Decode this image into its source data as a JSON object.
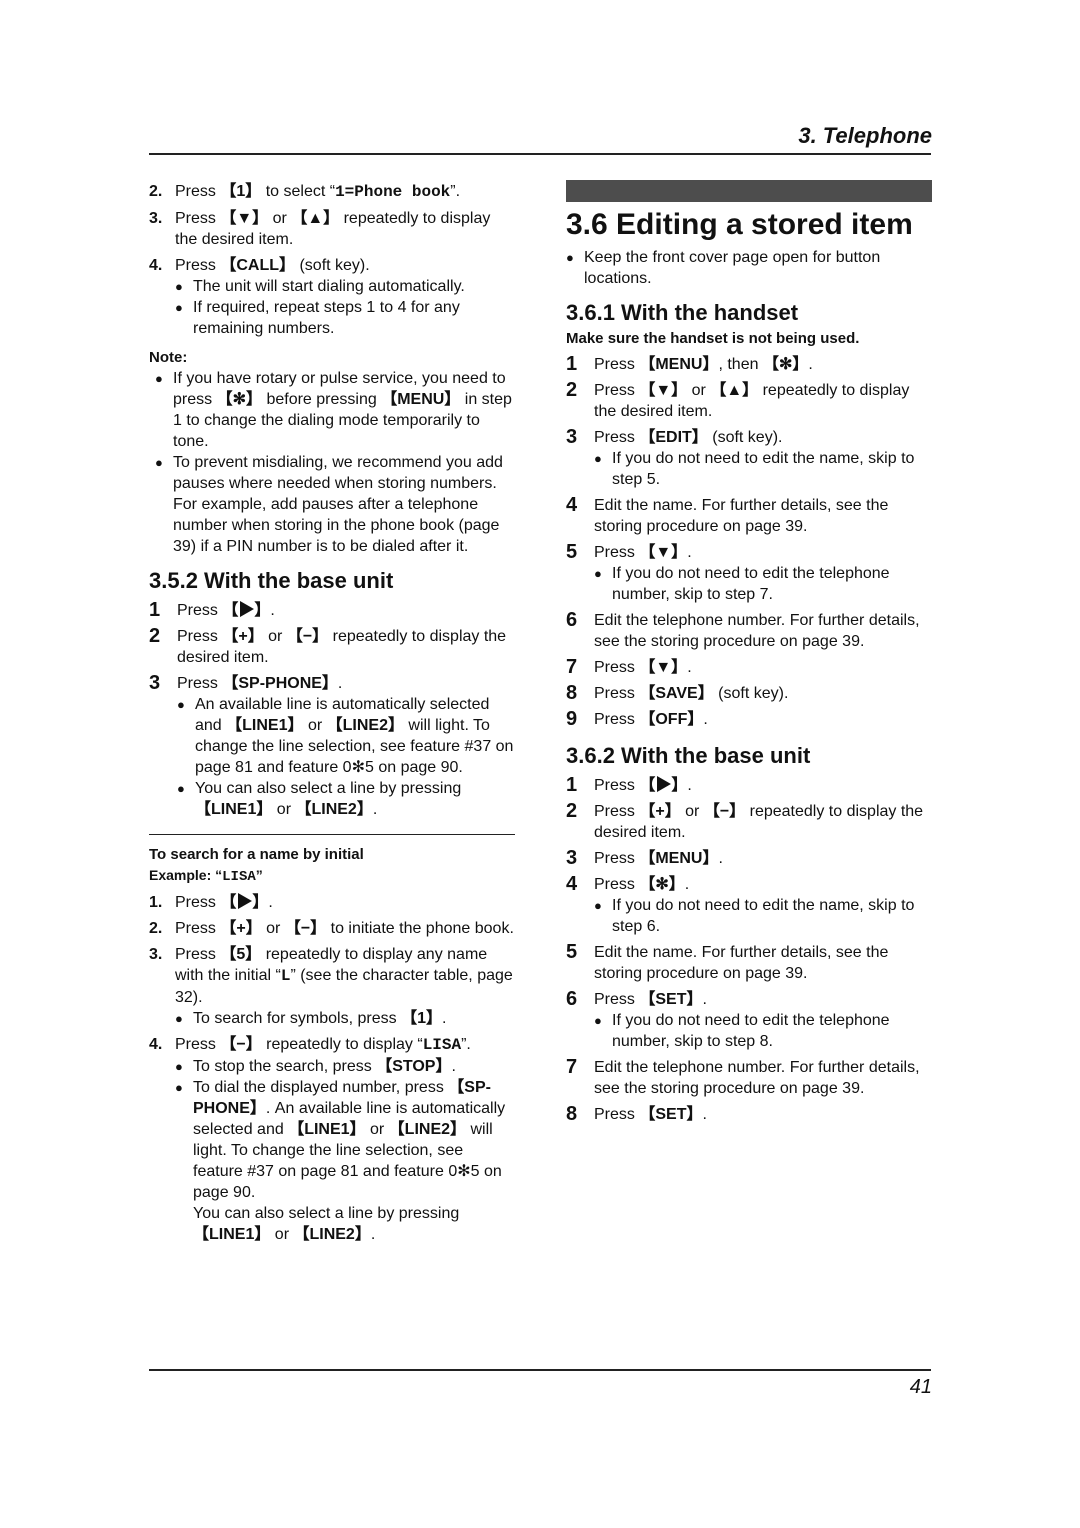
{
  "header": {
    "chapter": "3. Telephone"
  },
  "footer": {
    "page_number": "41"
  },
  "left": {
    "steps_top": [
      {
        "num": "2.",
        "text": "Press 【1】 to select “1=Phone book”."
      },
      {
        "num": "3.",
        "text": "Press 【▼】 or 【▲】 repeatedly to display the desired item."
      },
      {
        "num": "4.",
        "text": "Press 【CALL】 (soft key).",
        "bullets": [
          "The unit will start dialing automatically.",
          "If required, repeat steps 1 to 4 for any remaining numbers."
        ]
      }
    ],
    "note": {
      "title": "Note:",
      "bullets": [
        "If you have rotary or pulse service, you need to press 【✻】 before pressing 【MENU】 in step 1 to change the dialing mode temporarily to tone.",
        "To prevent misdialing, we recommend you add pauses where needed when storing numbers. For example, add pauses after a telephone number when storing in the phone book (page 39) if a PIN number is to be dialed after it."
      ]
    },
    "section_352": {
      "heading": "3.5.2 With the base unit",
      "steps": [
        {
          "num": "1",
          "text": "Press 【▶】."
        },
        {
          "num": "2",
          "text": "Press 【+】 or 【−】 repeatedly to display the desired item."
        },
        {
          "num": "3",
          "text": "Press 【SP-PHONE】.",
          "bullets": [
            "An available line is automatically selected and 【LINE1】 or 【LINE2】 will light. To change the line selection, see feature #37 on page 81 and feature 0✻5 on page 90.",
            "You can also select a line by pressing 【LINE1】 or 【LINE2】."
          ]
        }
      ]
    },
    "search": {
      "title": "To search for a name by initial",
      "example": "Example: “LISA”",
      "steps": [
        {
          "num": "1.",
          "text": "Press 【▶】."
        },
        {
          "num": "2.",
          "text": "Press 【+】 or 【−】 to initiate the phone book."
        },
        {
          "num": "3.",
          "text": "Press 【5】 repeatedly to display any name with the initial “L” (see the character table, page 32).",
          "bullets": [
            "To search for symbols, press 【1】."
          ]
        },
        {
          "num": "4.",
          "text": "Press 【−】 repeatedly to display “LISA”.",
          "bullets": [
            "To stop the search, press 【STOP】.",
            "To dial the displayed number, press 【SP-PHONE】. An available line is automatically selected and 【LINE1】 or 【LINE2】 will light. To change the line selection, see feature #37 on page 81 and feature 0✻5 on page 90."
          ],
          "extra": "You can also select a line by pressing 【LINE1】 or 【LINE2】."
        }
      ]
    }
  },
  "right": {
    "title": "3.6 Editing a stored item",
    "intro_bullet": "Keep the front cover page open for button locations.",
    "section_361": {
      "heading": "3.6.1 With the handset",
      "subhead": "Make sure the handset is not being used.",
      "steps": [
        {
          "num": "1",
          "text": "Press 【MENU】, then 【✻】."
        },
        {
          "num": "2",
          "text": "Press 【▼】 or 【▲】 repeatedly to display the desired item."
        },
        {
          "num": "3",
          "text": "Press 【EDIT】 (soft key).",
          "bullets": [
            "If you do not need to edit the name, skip to step 5."
          ]
        },
        {
          "num": "4",
          "text": "Edit the name. For further details, see the storing procedure on page 39."
        },
        {
          "num": "5",
          "text": "Press 【▼】.",
          "bullets": [
            "If you do not need to edit the telephone number, skip to step 7."
          ]
        },
        {
          "num": "6",
          "text": "Edit the telephone number. For further details, see the storing procedure on page 39."
        },
        {
          "num": "7",
          "text": "Press 【▼】."
        },
        {
          "num": "8",
          "text": "Press 【SAVE】 (soft key)."
        },
        {
          "num": "9",
          "text": "Press 【OFF】."
        }
      ]
    },
    "section_362": {
      "heading": "3.6.2 With the base unit",
      "steps": [
        {
          "num": "1",
          "text": "Press 【▶】."
        },
        {
          "num": "2",
          "text": "Press 【+】 or 【−】 repeatedly to display the desired item."
        },
        {
          "num": "3",
          "text": "Press 【MENU】."
        },
        {
          "num": "4",
          "text": "Press 【✻】.",
          "bullets": [
            "If you do not need to edit the name, skip to step 6."
          ]
        },
        {
          "num": "5",
          "text": "Edit the name. For further details, see the storing procedure on page 39."
        },
        {
          "num": "6",
          "text": "Press 【SET】.",
          "bullets": [
            "If you do not need to edit the telephone number, skip to step 8."
          ]
        },
        {
          "num": "7",
          "text": "Edit the telephone number. For further details, see the storing procedure on page 39."
        },
        {
          "num": "8",
          "text": "Press 【SET】."
        }
      ]
    }
  }
}
